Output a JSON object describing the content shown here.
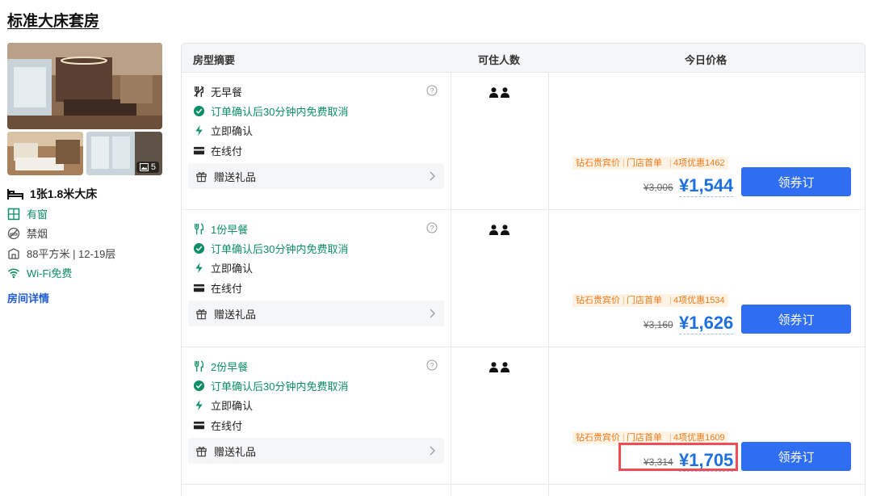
{
  "room": {
    "title": "标准大床套房",
    "photo_count": "5",
    "bed": "1张1.8米大床",
    "window": "有窗",
    "smoking": "禁烟",
    "area_floor": "88平方米 | 12-19层",
    "wifi": "Wi-Fi免费",
    "detail_link": "房间详情"
  },
  "table": {
    "headers": {
      "summary": "房型摘要",
      "guests": "可住人数",
      "price": "今日价格"
    },
    "rows": [
      {
        "meal": "无早餐",
        "cancel": "订单确认后30分钟内免费取消",
        "confirm": "立即确认",
        "payment": "在线付",
        "gift": "赠送礼品",
        "tags": [
          "钻石贵宾价",
          "门店首单",
          "4项优惠1462"
        ],
        "original_price": "¥3,006",
        "price": "¥1,544",
        "button": "领券订"
      },
      {
        "meal": "1份早餐",
        "cancel": "订单确认后30分钟内免费取消",
        "confirm": "立即确认",
        "payment": "在线付",
        "gift": "赠送礼品",
        "tags": [
          "钻石贵宾价",
          "门店首单",
          "4项优惠1534"
        ],
        "original_price": "¥3,160",
        "price": "¥1,626",
        "button": "领券订"
      },
      {
        "meal": "2份早餐",
        "cancel": "订单确认后30分钟内免费取消",
        "confirm": "立即确认",
        "payment": "在线付",
        "gift": "赠送礼品",
        "tags": [
          "钻石贵宾价",
          "门店首单",
          "4项优惠1609"
        ],
        "original_price": "¥3,314",
        "price": "¥1,705",
        "button": "领券订"
      }
    ]
  },
  "colors": {
    "accent_blue": "#2f6ef3",
    "price_blue": "#1e6fe0",
    "green": "#0d8f62",
    "tag_orange": "#f07a1a",
    "highlight_red": "#ef4c55"
  },
  "icons": [
    "bed-icon",
    "window-icon",
    "no-smoking-icon",
    "area-icon",
    "wifi-icon",
    "no-breakfast-icon",
    "breakfast-icon",
    "check-circle-icon",
    "lightning-icon",
    "card-icon",
    "gift-icon",
    "help-icon",
    "chevron-right-icon",
    "person-icon",
    "image-icon"
  ]
}
